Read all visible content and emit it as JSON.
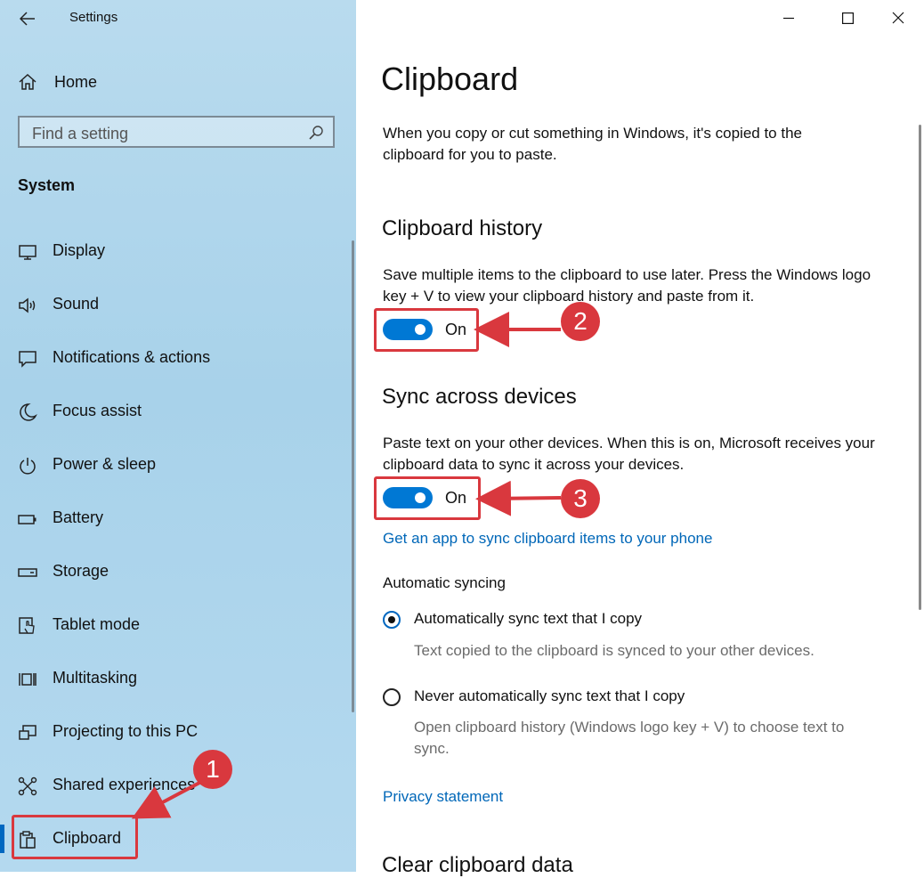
{
  "window": {
    "title": "Settings",
    "controls": [
      "minimize",
      "maximize",
      "close"
    ]
  },
  "sidebar": {
    "home_label": "Home",
    "search": {
      "placeholder": "Find a setting"
    },
    "section_title": "System",
    "items": [
      {
        "label": "Display",
        "icon": "monitor-icon"
      },
      {
        "label": "Sound",
        "icon": "speaker-icon"
      },
      {
        "label": "Notifications & actions",
        "icon": "notification-icon"
      },
      {
        "label": "Focus assist",
        "icon": "moon-icon"
      },
      {
        "label": "Power & sleep",
        "icon": "power-icon"
      },
      {
        "label": "Battery",
        "icon": "battery-icon"
      },
      {
        "label": "Storage",
        "icon": "storage-icon"
      },
      {
        "label": "Tablet mode",
        "icon": "tablet-mode-icon"
      },
      {
        "label": "Multitasking",
        "icon": "multitasking-icon"
      },
      {
        "label": "Projecting to this PC",
        "icon": "projecting-icon"
      },
      {
        "label": "Shared experiences",
        "icon": "shared-experiences-icon"
      },
      {
        "label": "Clipboard",
        "icon": "clipboard-icon",
        "selected": true
      }
    ]
  },
  "main": {
    "title": "Clipboard",
    "intro": "When you copy or cut something in Windows, it's copied to the clipboard for you to paste.",
    "history": {
      "heading": "Clipboard history",
      "description": "Save multiple items to the clipboard to use later. Press the Windows logo key + V to view your clipboard history and paste from it.",
      "toggle_label": "On",
      "toggle_on": true
    },
    "sync": {
      "heading": "Sync across devices",
      "description": "Paste text on your other devices. When this is on, Microsoft receives your clipboard data to sync it across your devices.",
      "toggle_label": "On",
      "toggle_on": true,
      "app_link": "Get an app to sync clipboard items to your phone",
      "auto_heading": "Automatic syncing",
      "options": [
        {
          "label": "Automatically sync text that I copy",
          "description": "Text copied to the clipboard is synced to your other devices.",
          "selected": true
        },
        {
          "label": "Never automatically sync text that I copy",
          "description": "Open clipboard history (Windows logo key + V) to choose text to sync.",
          "selected": false
        }
      ]
    },
    "privacy_link": "Privacy statement",
    "clear_heading": "Clear clipboard data"
  },
  "annotations": [
    {
      "number": "1"
    },
    {
      "number": "2"
    },
    {
      "number": "3"
    }
  ],
  "colors": {
    "accent": "#0078d4",
    "link": "#0067b8",
    "annotation_red": "#d9383e",
    "sidebar_bg": "#a8d2ea"
  }
}
